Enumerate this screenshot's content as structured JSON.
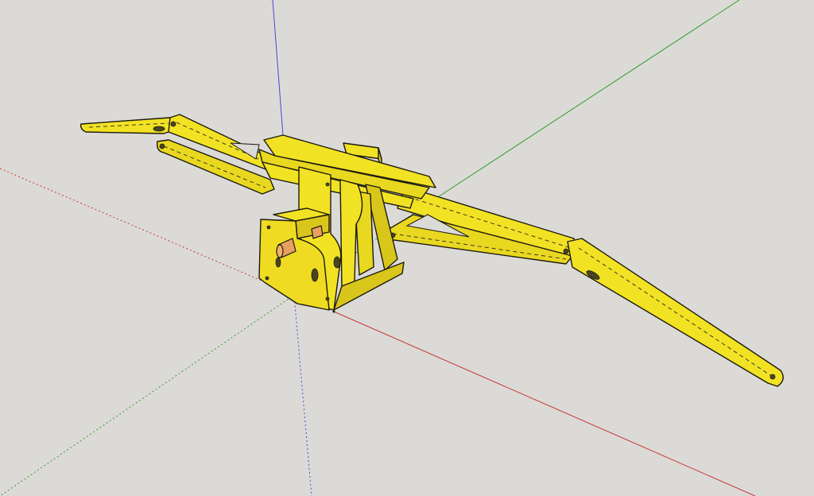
{
  "colors": {
    "background": "#dcdad6",
    "part_face": "#f2e224",
    "part_shade": "#d9c61a",
    "part_dark": "#bfae12",
    "edge": "#1c1a10",
    "pin": "#e8a060",
    "axis_red": "#c23a3a",
    "axis_green": "#2fa12f",
    "axis_blue": "#4a4ad0"
  },
  "icons": {
    "origin": "axes-origin-icon"
  }
}
